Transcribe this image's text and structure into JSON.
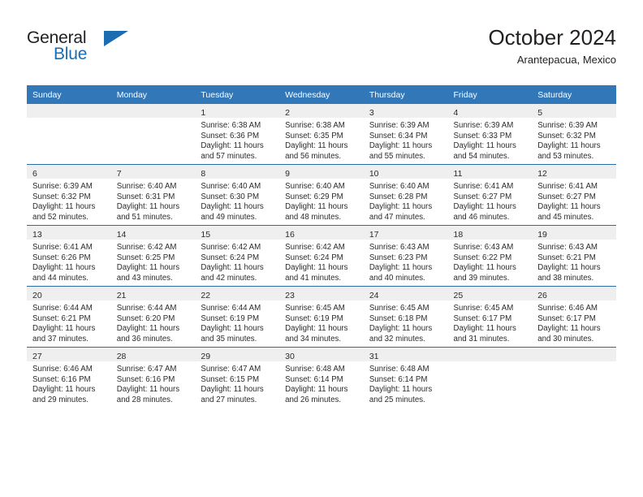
{
  "brand": {
    "line1": "General",
    "line2": "Blue",
    "triangle_color": "#1b6cb0"
  },
  "header": {
    "title": "October 2024",
    "subtitle": "Arantepacua, Mexico"
  },
  "theme": {
    "header_bar": "#3277b8",
    "row_divider": "#2b6ca8",
    "daynum_band": "#efefef",
    "text": "#2b2b2b"
  },
  "labels": {
    "sunrise_prefix": "Sunrise:",
    "sunset_prefix": "Sunset:",
    "daylight_prefix": "Daylight:"
  },
  "weekday_headers": [
    "Sunday",
    "Monday",
    "Tuesday",
    "Wednesday",
    "Thursday",
    "Friday",
    "Saturday"
  ],
  "weeks": [
    [
      {
        "empty": true
      },
      {
        "empty": true
      },
      {
        "day": "1",
        "sunrise": "Sunrise: 6:38 AM",
        "sunset": "Sunset: 6:36 PM",
        "daylight_l1": "Daylight: 11 hours",
        "daylight_l2": "and 57 minutes."
      },
      {
        "day": "2",
        "sunrise": "Sunrise: 6:38 AM",
        "sunset": "Sunset: 6:35 PM",
        "daylight_l1": "Daylight: 11 hours",
        "daylight_l2": "and 56 minutes."
      },
      {
        "day": "3",
        "sunrise": "Sunrise: 6:39 AM",
        "sunset": "Sunset: 6:34 PM",
        "daylight_l1": "Daylight: 11 hours",
        "daylight_l2": "and 55 minutes."
      },
      {
        "day": "4",
        "sunrise": "Sunrise: 6:39 AM",
        "sunset": "Sunset: 6:33 PM",
        "daylight_l1": "Daylight: 11 hours",
        "daylight_l2": "and 54 minutes."
      },
      {
        "day": "5",
        "sunrise": "Sunrise: 6:39 AM",
        "sunset": "Sunset: 6:32 PM",
        "daylight_l1": "Daylight: 11 hours",
        "daylight_l2": "and 53 minutes."
      }
    ],
    [
      {
        "day": "6",
        "sunrise": "Sunrise: 6:39 AM",
        "sunset": "Sunset: 6:32 PM",
        "daylight_l1": "Daylight: 11 hours",
        "daylight_l2": "and 52 minutes."
      },
      {
        "day": "7",
        "sunrise": "Sunrise: 6:40 AM",
        "sunset": "Sunset: 6:31 PM",
        "daylight_l1": "Daylight: 11 hours",
        "daylight_l2": "and 51 minutes."
      },
      {
        "day": "8",
        "sunrise": "Sunrise: 6:40 AM",
        "sunset": "Sunset: 6:30 PM",
        "daylight_l1": "Daylight: 11 hours",
        "daylight_l2": "and 49 minutes."
      },
      {
        "day": "9",
        "sunrise": "Sunrise: 6:40 AM",
        "sunset": "Sunset: 6:29 PM",
        "daylight_l1": "Daylight: 11 hours",
        "daylight_l2": "and 48 minutes."
      },
      {
        "day": "10",
        "sunrise": "Sunrise: 6:40 AM",
        "sunset": "Sunset: 6:28 PM",
        "daylight_l1": "Daylight: 11 hours",
        "daylight_l2": "and 47 minutes."
      },
      {
        "day": "11",
        "sunrise": "Sunrise: 6:41 AM",
        "sunset": "Sunset: 6:27 PM",
        "daylight_l1": "Daylight: 11 hours",
        "daylight_l2": "and 46 minutes."
      },
      {
        "day": "12",
        "sunrise": "Sunrise: 6:41 AM",
        "sunset": "Sunset: 6:27 PM",
        "daylight_l1": "Daylight: 11 hours",
        "daylight_l2": "and 45 minutes."
      }
    ],
    [
      {
        "day": "13",
        "sunrise": "Sunrise: 6:41 AM",
        "sunset": "Sunset: 6:26 PM",
        "daylight_l1": "Daylight: 11 hours",
        "daylight_l2": "and 44 minutes."
      },
      {
        "day": "14",
        "sunrise": "Sunrise: 6:42 AM",
        "sunset": "Sunset: 6:25 PM",
        "daylight_l1": "Daylight: 11 hours",
        "daylight_l2": "and 43 minutes."
      },
      {
        "day": "15",
        "sunrise": "Sunrise: 6:42 AM",
        "sunset": "Sunset: 6:24 PM",
        "daylight_l1": "Daylight: 11 hours",
        "daylight_l2": "and 42 minutes."
      },
      {
        "day": "16",
        "sunrise": "Sunrise: 6:42 AM",
        "sunset": "Sunset: 6:24 PM",
        "daylight_l1": "Daylight: 11 hours",
        "daylight_l2": "and 41 minutes."
      },
      {
        "day": "17",
        "sunrise": "Sunrise: 6:43 AM",
        "sunset": "Sunset: 6:23 PM",
        "daylight_l1": "Daylight: 11 hours",
        "daylight_l2": "and 40 minutes."
      },
      {
        "day": "18",
        "sunrise": "Sunrise: 6:43 AM",
        "sunset": "Sunset: 6:22 PM",
        "daylight_l1": "Daylight: 11 hours",
        "daylight_l2": "and 39 minutes."
      },
      {
        "day": "19",
        "sunrise": "Sunrise: 6:43 AM",
        "sunset": "Sunset: 6:21 PM",
        "daylight_l1": "Daylight: 11 hours",
        "daylight_l2": "and 38 minutes."
      }
    ],
    [
      {
        "day": "20",
        "sunrise": "Sunrise: 6:44 AM",
        "sunset": "Sunset: 6:21 PM",
        "daylight_l1": "Daylight: 11 hours",
        "daylight_l2": "and 37 minutes."
      },
      {
        "day": "21",
        "sunrise": "Sunrise: 6:44 AM",
        "sunset": "Sunset: 6:20 PM",
        "daylight_l1": "Daylight: 11 hours",
        "daylight_l2": "and 36 minutes."
      },
      {
        "day": "22",
        "sunrise": "Sunrise: 6:44 AM",
        "sunset": "Sunset: 6:19 PM",
        "daylight_l1": "Daylight: 11 hours",
        "daylight_l2": "and 35 minutes."
      },
      {
        "day": "23",
        "sunrise": "Sunrise: 6:45 AM",
        "sunset": "Sunset: 6:19 PM",
        "daylight_l1": "Daylight: 11 hours",
        "daylight_l2": "and 34 minutes."
      },
      {
        "day": "24",
        "sunrise": "Sunrise: 6:45 AM",
        "sunset": "Sunset: 6:18 PM",
        "daylight_l1": "Daylight: 11 hours",
        "daylight_l2": "and 32 minutes."
      },
      {
        "day": "25",
        "sunrise": "Sunrise: 6:45 AM",
        "sunset": "Sunset: 6:17 PM",
        "daylight_l1": "Daylight: 11 hours",
        "daylight_l2": "and 31 minutes."
      },
      {
        "day": "26",
        "sunrise": "Sunrise: 6:46 AM",
        "sunset": "Sunset: 6:17 PM",
        "daylight_l1": "Daylight: 11 hours",
        "daylight_l2": "and 30 minutes."
      }
    ],
    [
      {
        "day": "27",
        "sunrise": "Sunrise: 6:46 AM",
        "sunset": "Sunset: 6:16 PM",
        "daylight_l1": "Daylight: 11 hours",
        "daylight_l2": "and 29 minutes."
      },
      {
        "day": "28",
        "sunrise": "Sunrise: 6:47 AM",
        "sunset": "Sunset: 6:16 PM",
        "daylight_l1": "Daylight: 11 hours",
        "daylight_l2": "and 28 minutes."
      },
      {
        "day": "29",
        "sunrise": "Sunrise: 6:47 AM",
        "sunset": "Sunset: 6:15 PM",
        "daylight_l1": "Daylight: 11 hours",
        "daylight_l2": "and 27 minutes."
      },
      {
        "day": "30",
        "sunrise": "Sunrise: 6:48 AM",
        "sunset": "Sunset: 6:14 PM",
        "daylight_l1": "Daylight: 11 hours",
        "daylight_l2": "and 26 minutes."
      },
      {
        "day": "31",
        "sunrise": "Sunrise: 6:48 AM",
        "sunset": "Sunset: 6:14 PM",
        "daylight_l1": "Daylight: 11 hours",
        "daylight_l2": "and 25 minutes."
      },
      {
        "empty": true
      },
      {
        "empty": true
      }
    ]
  ]
}
